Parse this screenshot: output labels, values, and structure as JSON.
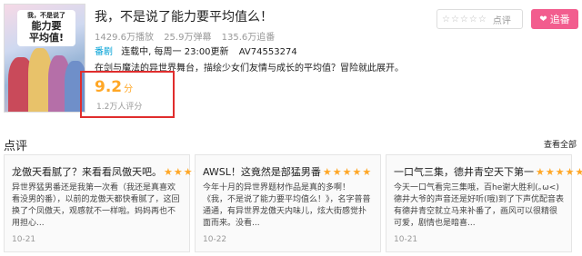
{
  "poster": {
    "title_line1": "我，不是说了",
    "title_line2": "能力要",
    "title_line3": "平均值!"
  },
  "title": "我，不是说了能力要平均值么！",
  "stats": {
    "plays": "1429.6万播放",
    "danmaku": "25.9万弹幕",
    "follows": "135.6万追番"
  },
  "meta": {
    "tag": "番剧",
    "schedule": "连载中, 每周一 23:00更新",
    "av": "AV74553274"
  },
  "description": "在剑与魔法的异世界舞台，描绘少女们友情与成长的平均值？冒险就此展开。",
  "score": {
    "value": "9.2",
    "unit": "分",
    "count": "1.2万人评分"
  },
  "rate": {
    "stars": "☆☆☆☆☆",
    "label": "点评"
  },
  "follow_label": "追番",
  "reviews_section": {
    "title": "点评",
    "view_all": "查看全部"
  },
  "reviews": [
    {
      "title": "龙傲天看腻了？来看看凤傲天吧。",
      "stars": "★★★★★",
      "text": "异世界猛男番还是我第一次看（我还是真喜欢看没男的番），以前的龙傲天都快看腻了，这回换了个凤傲天，观感就不一样啦。妈妈再也不用担心...",
      "date": "10-21"
    },
    {
      "title": "AWSL！这竟然是部猛男番",
      "stars": "★★★★★",
      "text": "今年十月的异世界题材作品是真的多啊！《我，不是说了能力要平均值么！》，名字普普通通，有异世界龙傲天内味儿，炫大街感觉扑面而来。没看...",
      "date": "10-22"
    },
    {
      "title": "一口气三集，德井青空天下第一",
      "stars": "★★★★★",
      "text": "今天一口气看完三集哦，百he谢大胜利(｡ω<)德井大爷的声音还是好听(哦)到了下声优配音表有德井青空就立马来补番了，画风可以很精很可爱，剧情也是暗喜...",
      "date": "10-21"
    }
  ]
}
